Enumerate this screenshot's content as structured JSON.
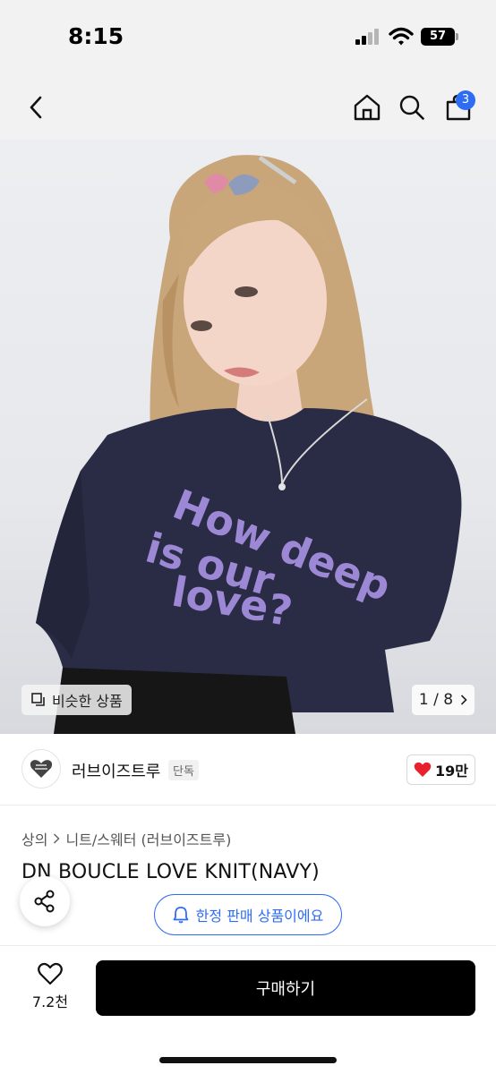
{
  "status_bar": {
    "time": "8:15",
    "battery": "57"
  },
  "header": {
    "cart_count": "3"
  },
  "hero": {
    "similar_label": "비슷한 상품",
    "page_current": "1",
    "page_total": "8",
    "page_separator": "/",
    "shirt_text_lines": [
      "How deep",
      "is our",
      "love?"
    ]
  },
  "brand": {
    "name": "러브이즈트루",
    "tag": "단독",
    "likes": "19만"
  },
  "product": {
    "breadcrumb": [
      "상의",
      "니트/스웨터 (러브이즈트루)"
    ],
    "title": "DN BOUCLE LOVE KNIT(NAVY)",
    "limited_label": "한정 판매 상품이에요"
  },
  "bottom_bar": {
    "wish_count": "7.2천",
    "buy_label": "구매하기"
  },
  "colors": {
    "accent": "#2f6cf5",
    "heart": "#e8212d",
    "buy": "#000000",
    "shirt": "#2a2c45",
    "knit_text": "#9d88d6"
  }
}
